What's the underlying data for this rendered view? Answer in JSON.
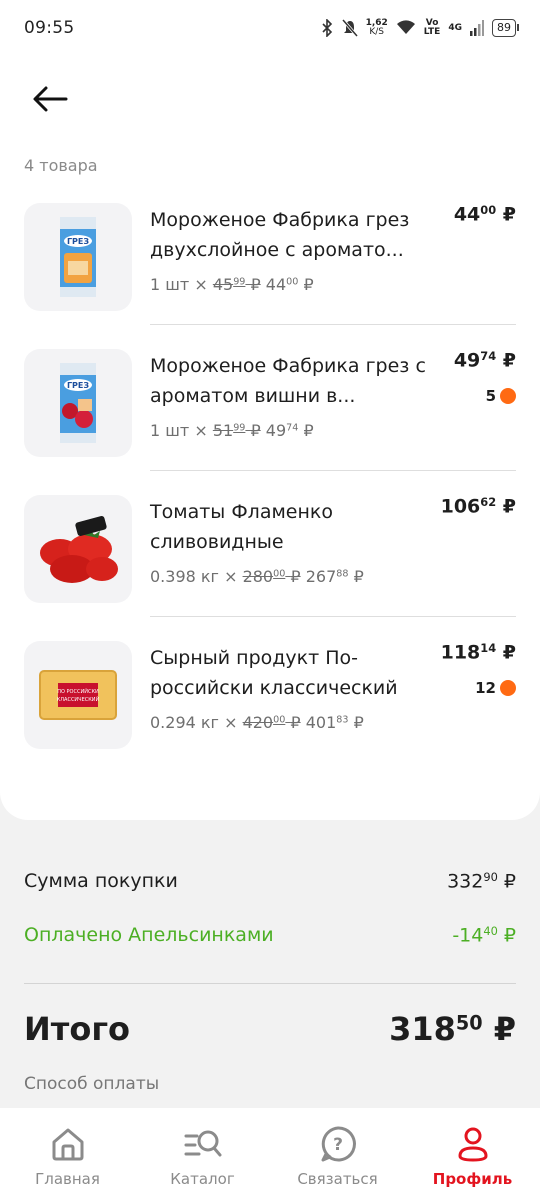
{
  "status": {
    "time": "09:55",
    "speed": "1,62",
    "speed_unit": "K/S",
    "volte": "Vo",
    "lte": "LTE",
    "net": "4G",
    "battery": "89"
  },
  "order": {
    "count_label": "4 товара",
    "items": [
      {
        "name": "Мороженое Фабрика грез двухслойное с арома­то...",
        "price_int": "44",
        "price_frac": "00",
        "currency": "₽",
        "qty": "1 шт",
        "times": "×",
        "old_int": "45",
        "old_frac": "99",
        "new_int": "44",
        "new_frac": "00",
        "bonus": ""
      },
      {
        "name": "Мороженое Фабрика грез с ароматом вишни в...",
        "price_int": "49",
        "price_frac": "74",
        "currency": "₽",
        "qty": "1 шт",
        "times": "×",
        "old_int": "51",
        "old_frac": "99",
        "new_int": "49",
        "new_frac": "74",
        "bonus": "5"
      },
      {
        "name": "Томаты Фламенко сливовидные",
        "price_int": "106",
        "price_frac": "62",
        "currency": "₽",
        "qty": "0.398 кг",
        "times": "×",
        "old_int": "280",
        "old_frac": "00",
        "new_int": "267",
        "new_frac": "88",
        "bonus": ""
      },
      {
        "name": "Сырный продукт По-российски классический",
        "price_int": "118",
        "price_frac": "14",
        "currency": "₽",
        "qty": "0.294 кг",
        "times": "×",
        "old_int": "420",
        "old_frac": "00",
        "new_int": "401",
        "new_frac": "83",
        "bonus": "12"
      }
    ],
    "cheese_label_1": "ПО РОССИЙСКИ",
    "cheese_label_2": "КЛАССИЧЕСКИЙ"
  },
  "summary": {
    "subtotal_label": "Сумма покупки",
    "subtotal_int": "332",
    "subtotal_frac": "90",
    "paid_label": "Оплачено Апельсинками",
    "paid_int": "-14",
    "paid_frac": "40",
    "total_label": "Итого",
    "total_int": "318",
    "total_frac": "50",
    "currency": "₽",
    "payment_method_label": "Способ оплаты"
  },
  "tabs": [
    {
      "label": "Главная",
      "icon": "home-icon"
    },
    {
      "label": "Каталог",
      "icon": "catalog-search-icon"
    },
    {
      "label": "Связаться",
      "icon": "help-icon"
    },
    {
      "label": "Профиль",
      "icon": "profile-icon",
      "active": true
    }
  ],
  "colors": {
    "accent": "#e3141f",
    "paid": "#4caf24",
    "bonus": "#ff6a13"
  }
}
